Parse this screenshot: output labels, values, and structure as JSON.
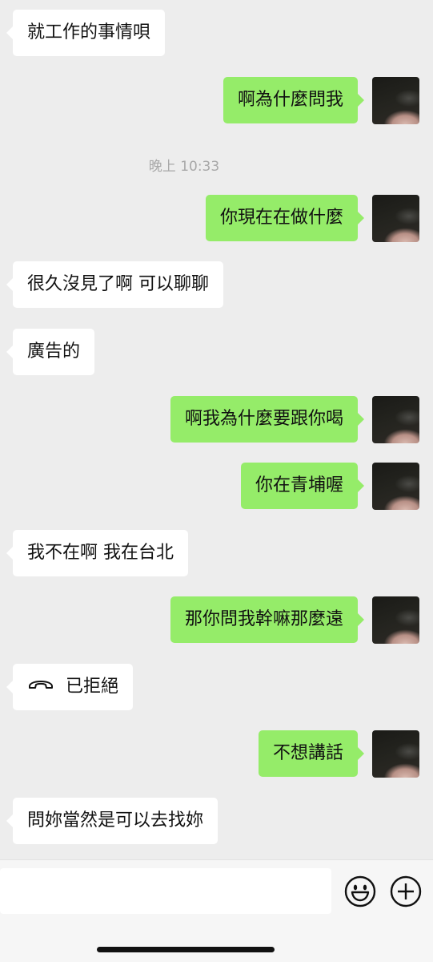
{
  "messages": [
    {
      "dir": "in",
      "text": "就工作的事情唄"
    },
    {
      "dir": "out",
      "text": "啊為什麼問我"
    },
    {
      "type": "time",
      "text": "晚上 10:33"
    },
    {
      "dir": "out",
      "text": "你現在在做什麼"
    },
    {
      "dir": "in",
      "text": "很久沒見了啊 可以聊聊"
    },
    {
      "dir": "in",
      "text": "廣告的"
    },
    {
      "dir": "out",
      "text": "啊我為什麼要跟你喝"
    },
    {
      "dir": "out",
      "text": "你在青埔喔"
    },
    {
      "dir": "in",
      "text": "我不在啊 我在台北"
    },
    {
      "dir": "out",
      "text": "那你問我幹嘛那麼遠"
    },
    {
      "dir": "in",
      "text": "已拒絕",
      "icon": "phone-declined-icon"
    },
    {
      "dir": "out",
      "text": "不想講話"
    },
    {
      "dir": "in",
      "text": "問妳當然是可以去找妳"
    }
  ],
  "input": {
    "value": "",
    "placeholder": ""
  },
  "toolbar": {
    "emoji_icon": "emoji-icon",
    "add_icon": "add-icon"
  },
  "colors": {
    "background": "#ededed",
    "outgoing_bubble": "#95ec69",
    "incoming_bubble": "#ffffff",
    "timestamp_text": "#a8a8a8"
  }
}
